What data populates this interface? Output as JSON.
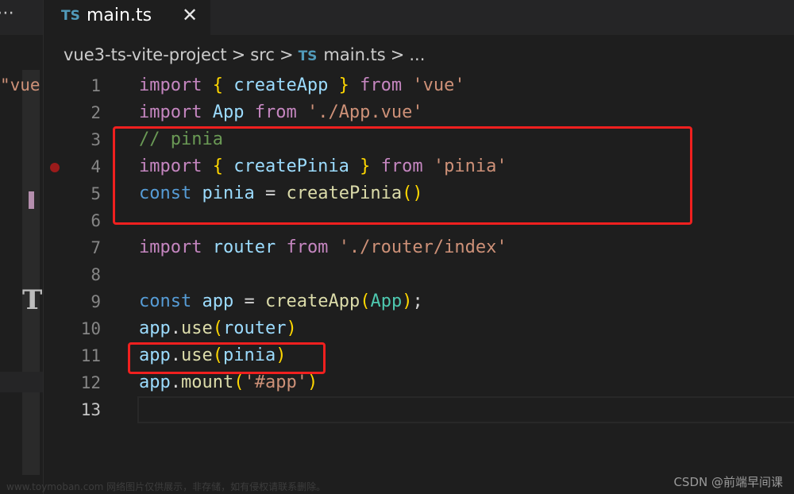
{
  "left_panel": {
    "more": "⋯",
    "snippet": "\"vue",
    "t_glyph": "T"
  },
  "tab": {
    "icon": "TS",
    "name": "main.ts",
    "close": "✕"
  },
  "breadcrumb": {
    "project": "vue3-ts-vite-project",
    "folder": "src",
    "icon": "TS",
    "file": "main.ts",
    "more": "...",
    "sep": ">"
  },
  "editor": {
    "lines": [
      {
        "n": "1",
        "tokens": [
          [
            "kw",
            "import "
          ],
          [
            "br",
            "{ "
          ],
          [
            "var",
            "createApp"
          ],
          [
            "br",
            " }"
          ],
          [
            "kw",
            " from "
          ],
          [
            "str",
            "'vue'"
          ]
        ]
      },
      {
        "n": "2",
        "tokens": [
          [
            "kw",
            "import "
          ],
          [
            "var",
            "App"
          ],
          [
            "kw",
            " from "
          ],
          [
            "str",
            "'./App.vue'"
          ]
        ]
      },
      {
        "n": "3",
        "tokens": [
          [
            "cmt",
            "// pinia"
          ]
        ]
      },
      {
        "n": "4",
        "tokens": [
          [
            "kw",
            "import "
          ],
          [
            "br",
            "{ "
          ],
          [
            "var",
            "createPinia"
          ],
          [
            "br",
            " }"
          ],
          [
            "kw",
            " from "
          ],
          [
            "str",
            "'pinia'"
          ]
        ]
      },
      {
        "n": "5",
        "tokens": [
          [
            "kwb",
            "const "
          ],
          [
            "var",
            "pinia"
          ],
          [
            "pl",
            " = "
          ],
          [
            "fn",
            "createPinia"
          ],
          [
            "br",
            "()"
          ]
        ]
      },
      {
        "n": "6",
        "tokens": []
      },
      {
        "n": "7",
        "tokens": [
          [
            "kw",
            "import "
          ],
          [
            "var",
            "router"
          ],
          [
            "kw",
            " from "
          ],
          [
            "str",
            "'./router/index'"
          ]
        ]
      },
      {
        "n": "8",
        "tokens": []
      },
      {
        "n": "9",
        "tokens": [
          [
            "kwb",
            "const "
          ],
          [
            "var",
            "app"
          ],
          [
            "pl",
            " = "
          ],
          [
            "fn",
            "createApp"
          ],
          [
            "br",
            "("
          ],
          [
            "cls",
            "App"
          ],
          [
            "br",
            ")"
          ],
          [
            "pl",
            ";"
          ]
        ]
      },
      {
        "n": "10",
        "tokens": [
          [
            "var",
            "app"
          ],
          [
            "pl",
            "."
          ],
          [
            "fn",
            "use"
          ],
          [
            "br",
            "("
          ],
          [
            "var",
            "router"
          ],
          [
            "br",
            ")"
          ]
        ]
      },
      {
        "n": "11",
        "tokens": [
          [
            "var",
            "app"
          ],
          [
            "pl",
            "."
          ],
          [
            "fn",
            "use"
          ],
          [
            "br",
            "("
          ],
          [
            "var",
            "pinia"
          ],
          [
            "br",
            ")"
          ]
        ]
      },
      {
        "n": "12",
        "tokens": [
          [
            "var",
            "app"
          ],
          [
            "pl",
            "."
          ],
          [
            "fn",
            "mount"
          ],
          [
            "br",
            "("
          ],
          [
            "str",
            "'#app'"
          ],
          [
            "br",
            ")"
          ]
        ]
      },
      {
        "n": "13",
        "tokens": []
      }
    ],
    "active_line": "13"
  },
  "watermark": {
    "left": "www.toymoban.com 网络图片仅供展示，非存储，如有侵权请联系删除。",
    "right": "CSDN @前端早间课"
  }
}
